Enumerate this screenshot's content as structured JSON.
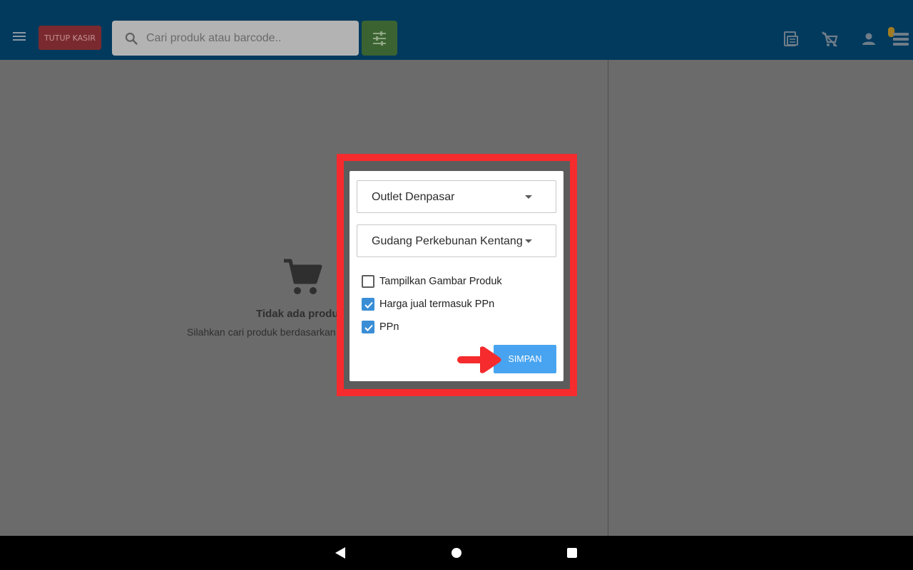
{
  "appbar": {
    "close_register_label": "TUTUP KASIR",
    "search_placeholder": "Cari produk atau barcode..",
    "search_value": ""
  },
  "empty_state": {
    "title": "Tidak ada produk",
    "subtitle": "Silahkan cari produk berdasarkan"
  },
  "dialog": {
    "outlet_select": {
      "value": "Outlet Denpasar"
    },
    "warehouse_select": {
      "value": "Gudang Perkebunan Kentang"
    },
    "checkboxes": [
      {
        "label": "Tampilkan Gambar Produk",
        "checked": false
      },
      {
        "label": "Harga jual termasuk PPn",
        "checked": true
      },
      {
        "label": "PPn",
        "checked": true
      }
    ],
    "save_label": "SIMPAN"
  },
  "colors": {
    "appbar": "#023a5e",
    "highlight": "#f52b2e",
    "primary_button": "#48a4f0",
    "checkbox_checked": "#3a8ed6"
  },
  "icons": [
    "menu-icon",
    "search-icon",
    "filter-sliders-icon",
    "receipt-icon",
    "remove-cart-icon",
    "person-icon",
    "list-icon",
    "cart-icon",
    "red-arrow-icon",
    "back-icon",
    "home-icon",
    "recents-icon"
  ]
}
